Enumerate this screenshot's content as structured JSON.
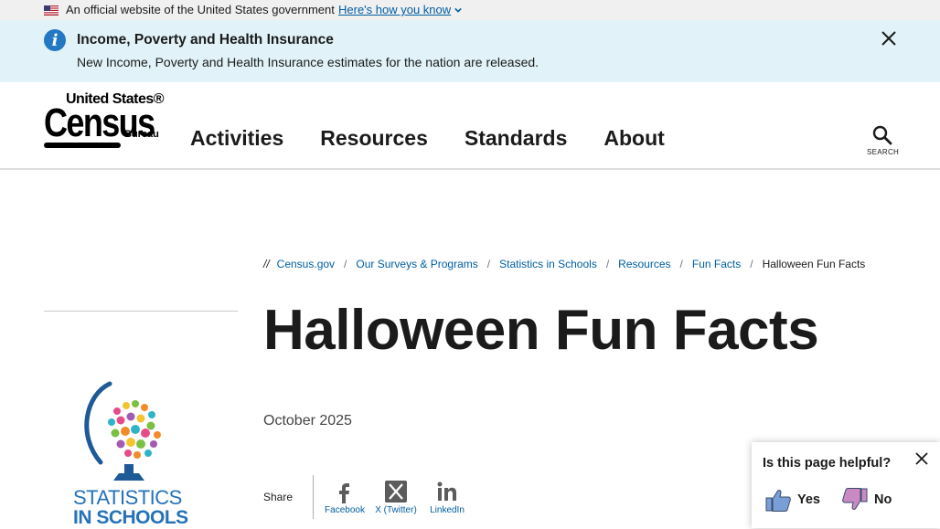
{
  "gov_banner": {
    "text": "An official website of the United States government",
    "link": "Here's how you know"
  },
  "alert": {
    "title": "Income, Poverty and Health Insurance",
    "body": "New Income, Poverty and Health Insurance estimates for the nation are released.",
    "icon": "info-icon"
  },
  "header": {
    "logo": {
      "top": "United States®",
      "main": "Census",
      "sub": "Bureau"
    },
    "nav": [
      "Activities",
      "Resources",
      "Standards",
      "About"
    ],
    "search_label": "SEARCH"
  },
  "breadcrumb": {
    "start": "//",
    "items": [
      "Census.gov",
      "Our Surveys & Programs",
      "Statistics in Schools",
      "Resources",
      "Fun Facts"
    ],
    "current": "Halloween Fun Facts"
  },
  "sidebar": {
    "logo_line1": "STATISTICS",
    "logo_line2": "IN SCHOOLS"
  },
  "main": {
    "title": "Halloween Fun Facts",
    "date": "October 2025",
    "share_label": "Share",
    "share_items": [
      "Facebook",
      "X (Twitter)",
      "LinkedIn"
    ]
  },
  "feedback": {
    "question": "Is this page helpful?",
    "yes": "Yes",
    "no": "No"
  },
  "colors": {
    "link": "#005ea2",
    "alert_bg": "#e1f3f8",
    "info": "#2378c3",
    "thumb": "#7a9fd6",
    "thumb_down": "#c98ac4"
  }
}
